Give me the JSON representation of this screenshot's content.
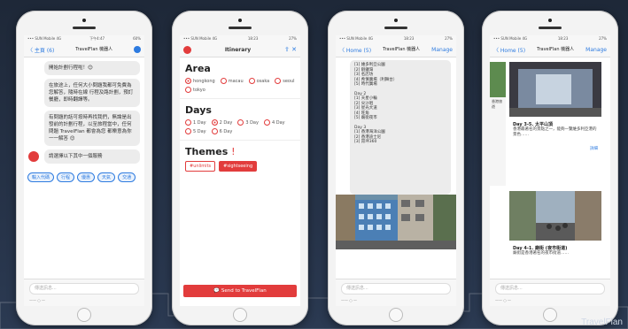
{
  "brand": "TravelFlan",
  "phones": {
    "p1": {
      "status_left": "••• SUN Mobile  4G",
      "status_time": "下午4:47",
      "status_right": "60%",
      "back": "〈 主頁 (6)",
      "title": "TravelFlan 機器人",
      "messages": [
        "開始計劃行程啦！😊",
        "在旅途上，任何大小問題我都可免費為您解答，隨時在線 行程及路計劃，預訂餐廳，即時翻譯等。",
        "有問題的話可按時再找我們，無論是出發前的計劃行程，以至旅程當中，任何問題 TravelFlan 都會為您 都樂意為你一一解答 😊",
        "請選擇以下其中一個服務"
      ],
      "chips": [
        "輸入代碼",
        "行程",
        "優惠",
        "天氣",
        "交通"
      ],
      "input_placeholder": "傳送訊息...",
      "keys": "—— ○ —"
    },
    "p2": {
      "status_left": "••• SUN Mobile  4G",
      "status_time": "18:23",
      "status_right": "27%",
      "title": "Itinerary",
      "area_title": "Area",
      "areas": [
        "hongkong",
        "macau",
        "osaka",
        "seoul",
        "tokyo"
      ],
      "days_title": "Days",
      "days": [
        "1 Day",
        "2 Day",
        "3 Day",
        "4 Day",
        "5 Day",
        "6 Day"
      ],
      "themes_title": "Themes",
      "themes_mark": "!",
      "themes": [
        "#unlimits",
        "#sightseeing"
      ],
      "send_label": "Send to TravelFlan"
    },
    "p3": {
      "status_left": "••• SUN Mobile  4G",
      "status_time": "18:23",
      "status_right": "27%",
      "back": "〈 Home (5)",
      "title": "TravelFlan 機器人",
      "manage": "Manage",
      "itinerary_lines": [
        "[1] 維多利亞公園",
        "[2] 銅鑼灣",
        "[3] 名店坊",
        "[4] 希慎廣場（利舞台）",
        "[5] 時代廣場",
        "",
        "Day 2",
        "[1] 天星小輪",
        "[2] 尖沙咀",
        "[3] 星光大道",
        "[4] 旺角",
        "[5] 廟街夜市",
        "",
        "Day 3",
        "[1] 香港海洋公園",
        "[2] 香港迪士尼",
        "[3] 昂坪360"
      ],
      "input_placeholder": "傳送訊息...",
      "keys": "—— ○ —"
    },
    "p4": {
      "status_left": "••• SUN Mobile  4G",
      "status_time": "18:23",
      "status_right": "27%",
      "back": "〈 Home (5)",
      "title": "TravelFlan 機器人",
      "manage": "Manage",
      "card1_title": "Day 3-5. 太平山頂",
      "card1_text": "香港最著名的景點之一，能夠一覽維多利亞港的景色……",
      "card1_link": "詳細",
      "card2_title": "Day 4-1. 廟街 (夜市街道)",
      "card2_text": "廟街是香港著名的夜市街道……",
      "side_text": "香港旅遊",
      "input_placeholder": "傳送訊息...",
      "keys": "—— ○ —"
    }
  },
  "colors": {
    "accent": "#e23c3c",
    "link": "#2d7be0"
  }
}
